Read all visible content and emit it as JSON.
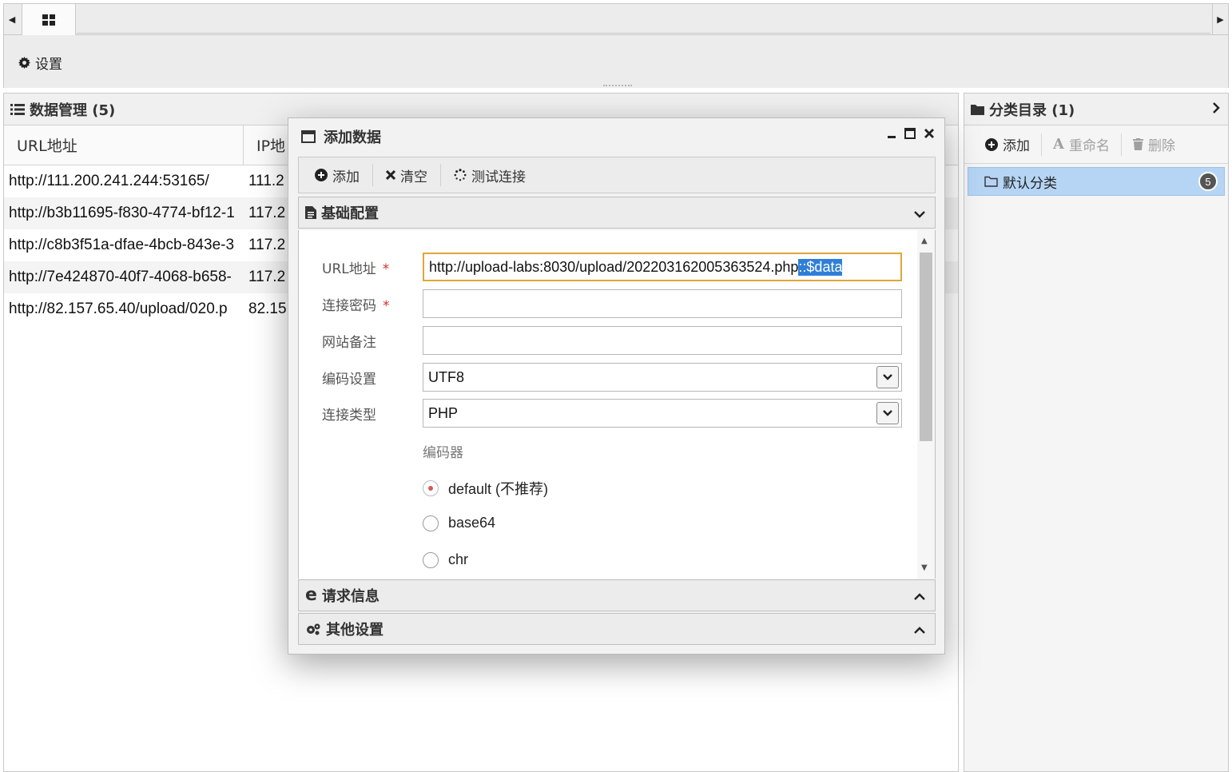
{
  "tabs": {
    "home_icon": "grid-icon"
  },
  "toolbar": {
    "settings_label": "设置"
  },
  "data_panel": {
    "title": "数据管理 (5)",
    "columns": [
      "URL地址",
      "IP地"
    ],
    "rows": [
      {
        "url": "http://111.200.241.244:53165/",
        "ip": "111.2"
      },
      {
        "url": "http://b3b11695-f830-4774-bf12-1",
        "ip": "117.2"
      },
      {
        "url": "http://c8b3f51a-dfae-4bcb-843e-3",
        "ip": "117.2"
      },
      {
        "url": "http://7e424870-40f7-4068-b658-",
        "ip": "117.2"
      },
      {
        "url": "http://82.157.65.40/upload/020.p",
        "ip": "82.15"
      }
    ]
  },
  "category_panel": {
    "title": "分类目录 (1)",
    "add_label": "添加",
    "rename_label": "重命名",
    "delete_label": "删除",
    "items": [
      {
        "label": "默认分类",
        "count": "5"
      }
    ]
  },
  "modal": {
    "title": "添加数据",
    "toolbar": {
      "add_label": "添加",
      "clear_label": "清空",
      "test_label": "测试连接"
    },
    "basic_section": "基础配置",
    "request_section": "请求信息",
    "other_section": "其他设置",
    "form": {
      "url_label": "URL地址",
      "url_value_plain": "http://upload-labs:8030/upload/202203162005363524.php",
      "url_value_selected": "::$data",
      "password_label": "连接密码",
      "password_value": "",
      "note_label": "网站备注",
      "note_value": "",
      "encoding_label": "编码设置",
      "encoding_value": "UTF8",
      "type_label": "连接类型",
      "type_value": "PHP",
      "required_mark": "*",
      "encoder_title": "编码器",
      "encoders": [
        {
          "label": "default (不推荐)",
          "checked": true
        },
        {
          "label": "base64",
          "checked": false
        },
        {
          "label": "chr",
          "checked": false
        }
      ]
    }
  },
  "colors": {
    "selection": "#2f7fd8",
    "focus_border": "#e0a63a",
    "category_selected": "#b6d5f5",
    "required": "#d43030"
  }
}
